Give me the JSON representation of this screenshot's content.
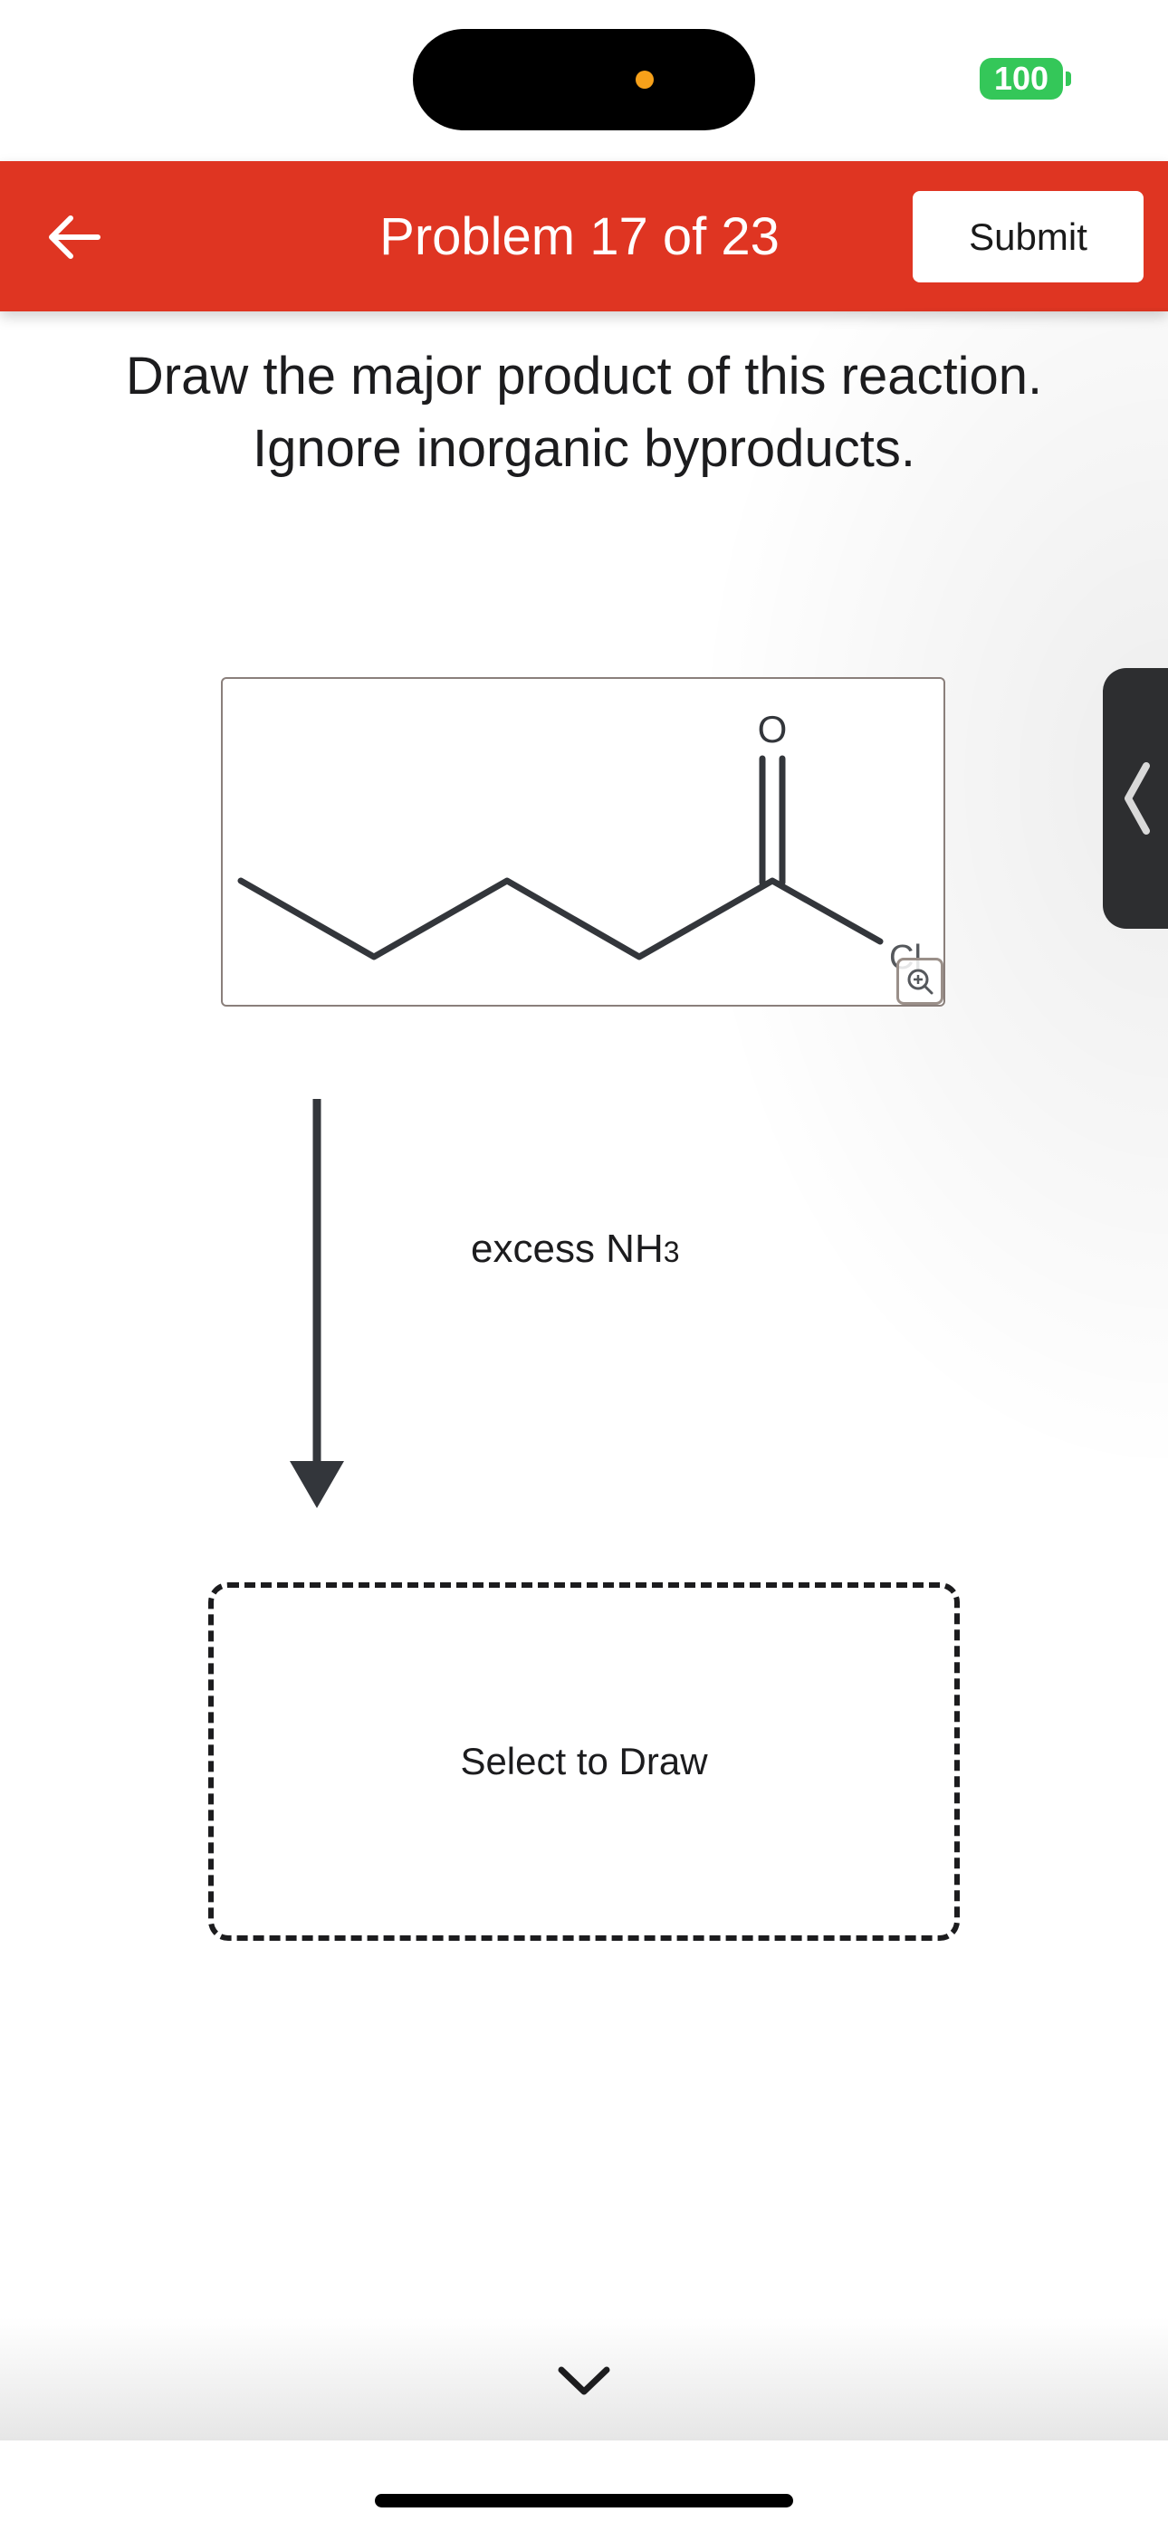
{
  "status_bar": {
    "battery_level": "100",
    "battery_color": "#34c759",
    "privacy_indicator_color": "#f7a11a"
  },
  "header": {
    "title": "Problem 17 of 23",
    "back_icon": "arrow-left-icon",
    "submit_label": "Submit",
    "background_color": "#df3522"
  },
  "prompt": {
    "line1": "Draw the major product of this reaction.",
    "line2": "Ignore inorganic byproducts."
  },
  "reactant": {
    "atom_oxygen": "O",
    "atom_chlorine": "Cl",
    "zoom_icon": "zoom-in-icon"
  },
  "reaction": {
    "reagent_main": "excess NH",
    "reagent_subscript": "3",
    "arrow_icon": "arrow-down-icon"
  },
  "answer": {
    "placeholder": "Select to Draw"
  },
  "side_panel": {
    "toggle_icon": "chevron-left-icon"
  },
  "bottom": {
    "scroll_icon": "chevron-down-icon"
  }
}
